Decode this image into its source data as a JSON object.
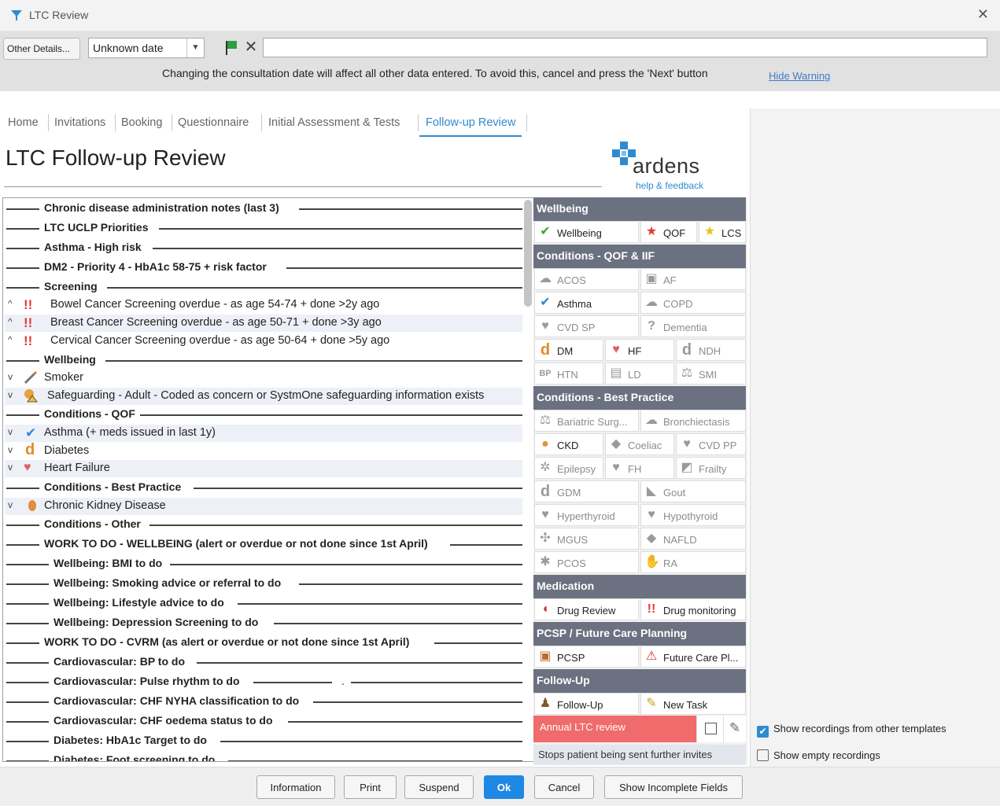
{
  "window": {
    "title": "LTC Review",
    "close_glyph": "✕"
  },
  "toolbar": {
    "other_details": "Other Details...",
    "date_value": "Unknown date",
    "free_text": "",
    "warning": "Changing the consultation date will affect all other data entered. To avoid this, cancel and press the 'Next' button",
    "hide_warning": "Hide Warning"
  },
  "tabs": [
    "Home",
    "Invitations",
    "Booking",
    "Questionnaire",
    "Initial Assessment & Tests",
    "Follow-up Review"
  ],
  "page": {
    "title": "LTC Follow-up Review"
  },
  "brand": {
    "name": "ardens",
    "help": "help & feedback"
  },
  "tree": {
    "headings": [
      "Chronic disease administration notes (last 3)",
      "LTC UCLP Priorities",
      "Asthma - High risk",
      "DM2 - Priority 4 - HbA1c 58-75 + risk factor",
      "Screening",
      "Wellbeing",
      "Conditions - QOF",
      "Conditions - Best Practice",
      "Conditions - Other",
      "WORK TO DO - WELLBEING (alert or overdue or not done since 1st April)",
      "Wellbeing: BMI to do",
      "Wellbeing: Smoking advice or referral to do",
      "Wellbeing: Lifestyle advice to do",
      "Wellbeing: Depression Screening to do",
      "WORK TO DO - CVRM (as alert or overdue or not done since 1st April)",
      "Cardiovascular: BP to do",
      "Cardiovascular: Pulse rhythm to do",
      "Cardiovascular: CHF NYHA classification to do",
      "Cardiovascular: CHF oedema status to do",
      "Diabetes: HbA1c Target to do",
      "Diabetes: Foot screening to do"
    ],
    "items": [
      "Bowel Cancer Screening overdue - as age 54-74 + done >2y ago",
      "Breast Cancer Screening overdue - as age 50-71 + done >3y ago",
      "Cervical Cancer Screening overdue - as age 50-64 + done >5y ago",
      "Smoker",
      "Safeguarding - Adult - Coded as concern or SystmOne safeguarding information exists",
      "Asthma (+ meds issued in last 1y)",
      "Diabetes",
      "Heart Failure",
      "Chronic Kidney Disease"
    ],
    "stray_dot": "."
  },
  "panel": {
    "sections": [
      "Wellbeing",
      "Conditions - QOF & IIF",
      "Conditions - Best Practice",
      "Medication",
      "PCSP / Future Care Planning",
      "Follow-Up"
    ],
    "buttons": {
      "wellbeing": "Wellbeing",
      "qof": "QOF",
      "lcs": "LCS",
      "acos": "ACOS",
      "af": "AF",
      "asthma": "Asthma",
      "copd": "COPD",
      "cvdsp": "CVD SP",
      "dementia": "Dementia",
      "dm": "DM",
      "hf": "HF",
      "ndh": "NDH",
      "htn": "HTN",
      "ld": "LD",
      "smi": "SMI",
      "bariatric": "Bariatric Surg...",
      "bronch": "Bronchiectasis",
      "ckd": "CKD",
      "coeliac": "Coeliac",
      "cvdpp": "CVD PP",
      "epilepsy": "Epilepsy",
      "fh": "FH",
      "frailty": "Frailty",
      "gdm": "GDM",
      "gout": "Gout",
      "hyper": "Hyperthyroid",
      "hypo": "Hypothyroid",
      "mgus": "MGUS",
      "nafld": "NAFLD",
      "pcos": "PCOS",
      "ra": "RA",
      "drug_review": "Drug Review",
      "drug_monitoring": "Drug monitoring",
      "pcsp": "PCSP",
      "future_care": "Future Care Pl...",
      "follow_up": "Follow-Up",
      "new_task": "New Task"
    },
    "annual": "Annual LTC review",
    "stops": "Stops patient being sent further invites"
  },
  "options": {
    "show_other": "Show recordings from other templates",
    "show_other_checked": true,
    "show_empty": "Show empty recordings",
    "show_empty_checked": false
  },
  "footer": {
    "information": "Information",
    "print": "Print",
    "suspend": "Suspend",
    "ok": "Ok",
    "cancel": "Cancel",
    "incomplete": "Show Incomplete Fields"
  },
  "colors": {
    "accent": "#2e8bd0",
    "panel_header": "#6b7180",
    "annual_bg": "#f06b6b",
    "ok_bg": "#1e88e5"
  }
}
